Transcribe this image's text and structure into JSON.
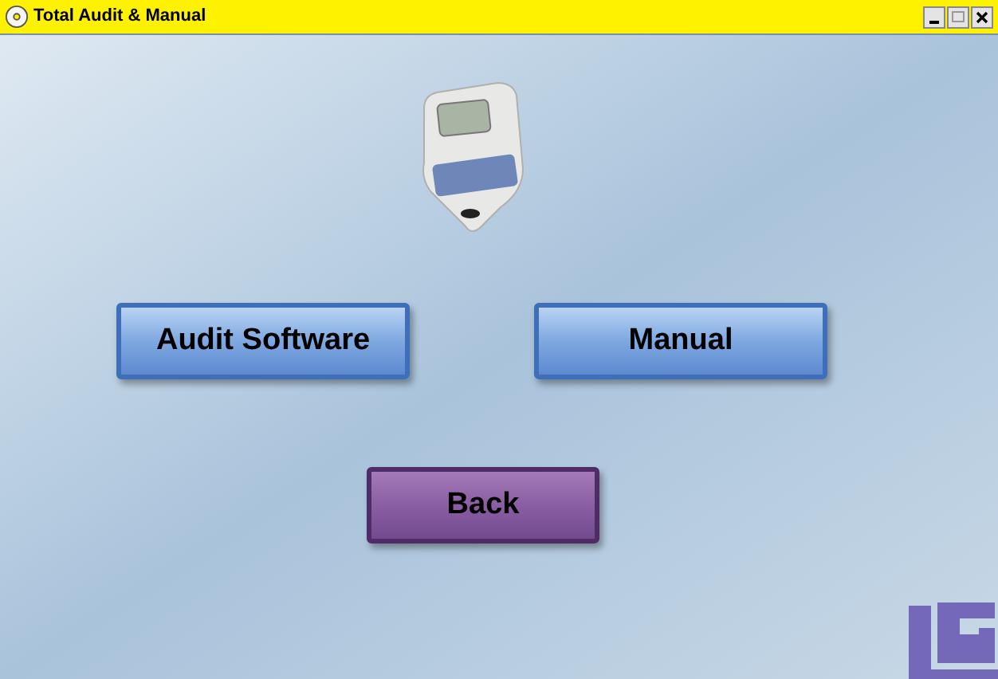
{
  "window": {
    "title": "Total Audit & Manual"
  },
  "buttons": [
    {
      "label": "Audit Software",
      "kind": "blue"
    },
    {
      "label": "Manual",
      "kind": "blue"
    },
    {
      "label": "Back",
      "kind": "purple"
    }
  ]
}
